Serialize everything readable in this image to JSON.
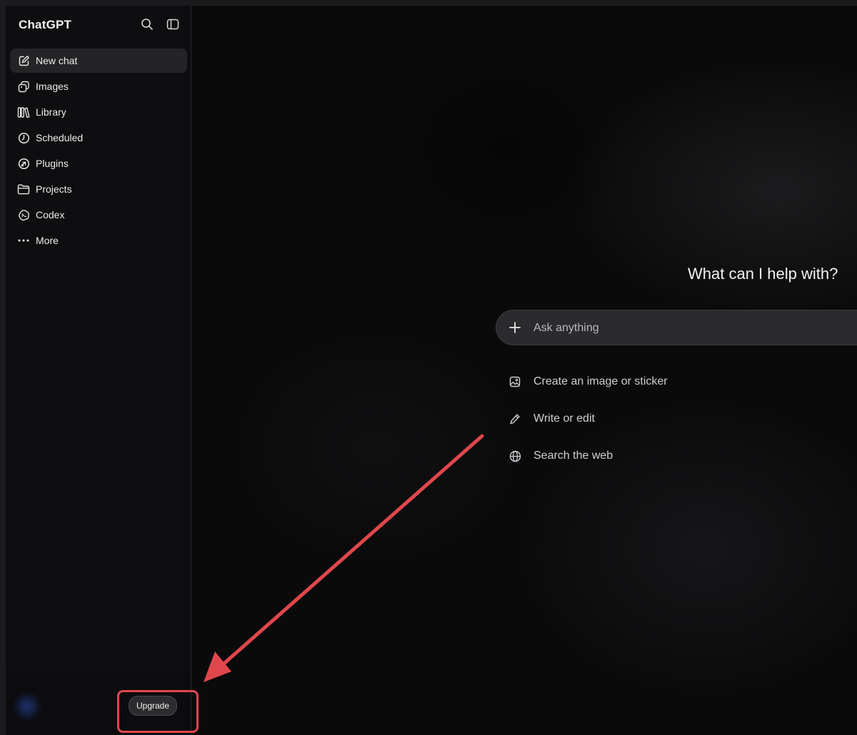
{
  "sidebar": {
    "brand": "ChatGPT",
    "items": [
      {
        "label": "New chat",
        "icon": "compose-icon"
      },
      {
        "label": "Images",
        "icon": "images-icon"
      },
      {
        "label": "Library",
        "icon": "library-icon"
      },
      {
        "label": "Scheduled",
        "icon": "clock-icon"
      },
      {
        "label": "Plugins",
        "icon": "plugins-icon"
      },
      {
        "label": "Projects",
        "icon": "folder-icon"
      },
      {
        "label": "Codex",
        "icon": "codex-icon"
      },
      {
        "label": "More",
        "icon": "more-icon"
      }
    ],
    "upgrade_label": "Upgrade"
  },
  "main": {
    "headline": "What can I help with?",
    "composer": {
      "placeholder": "Ask anything"
    },
    "suggestions": [
      {
        "label": "Create an image or sticker",
        "icon": "image-icon"
      },
      {
        "label": "Write or edit",
        "icon": "pencil-icon"
      },
      {
        "label": "Search the web",
        "icon": "globe-icon"
      }
    ]
  },
  "annotation": {
    "color": "#e0474c"
  }
}
